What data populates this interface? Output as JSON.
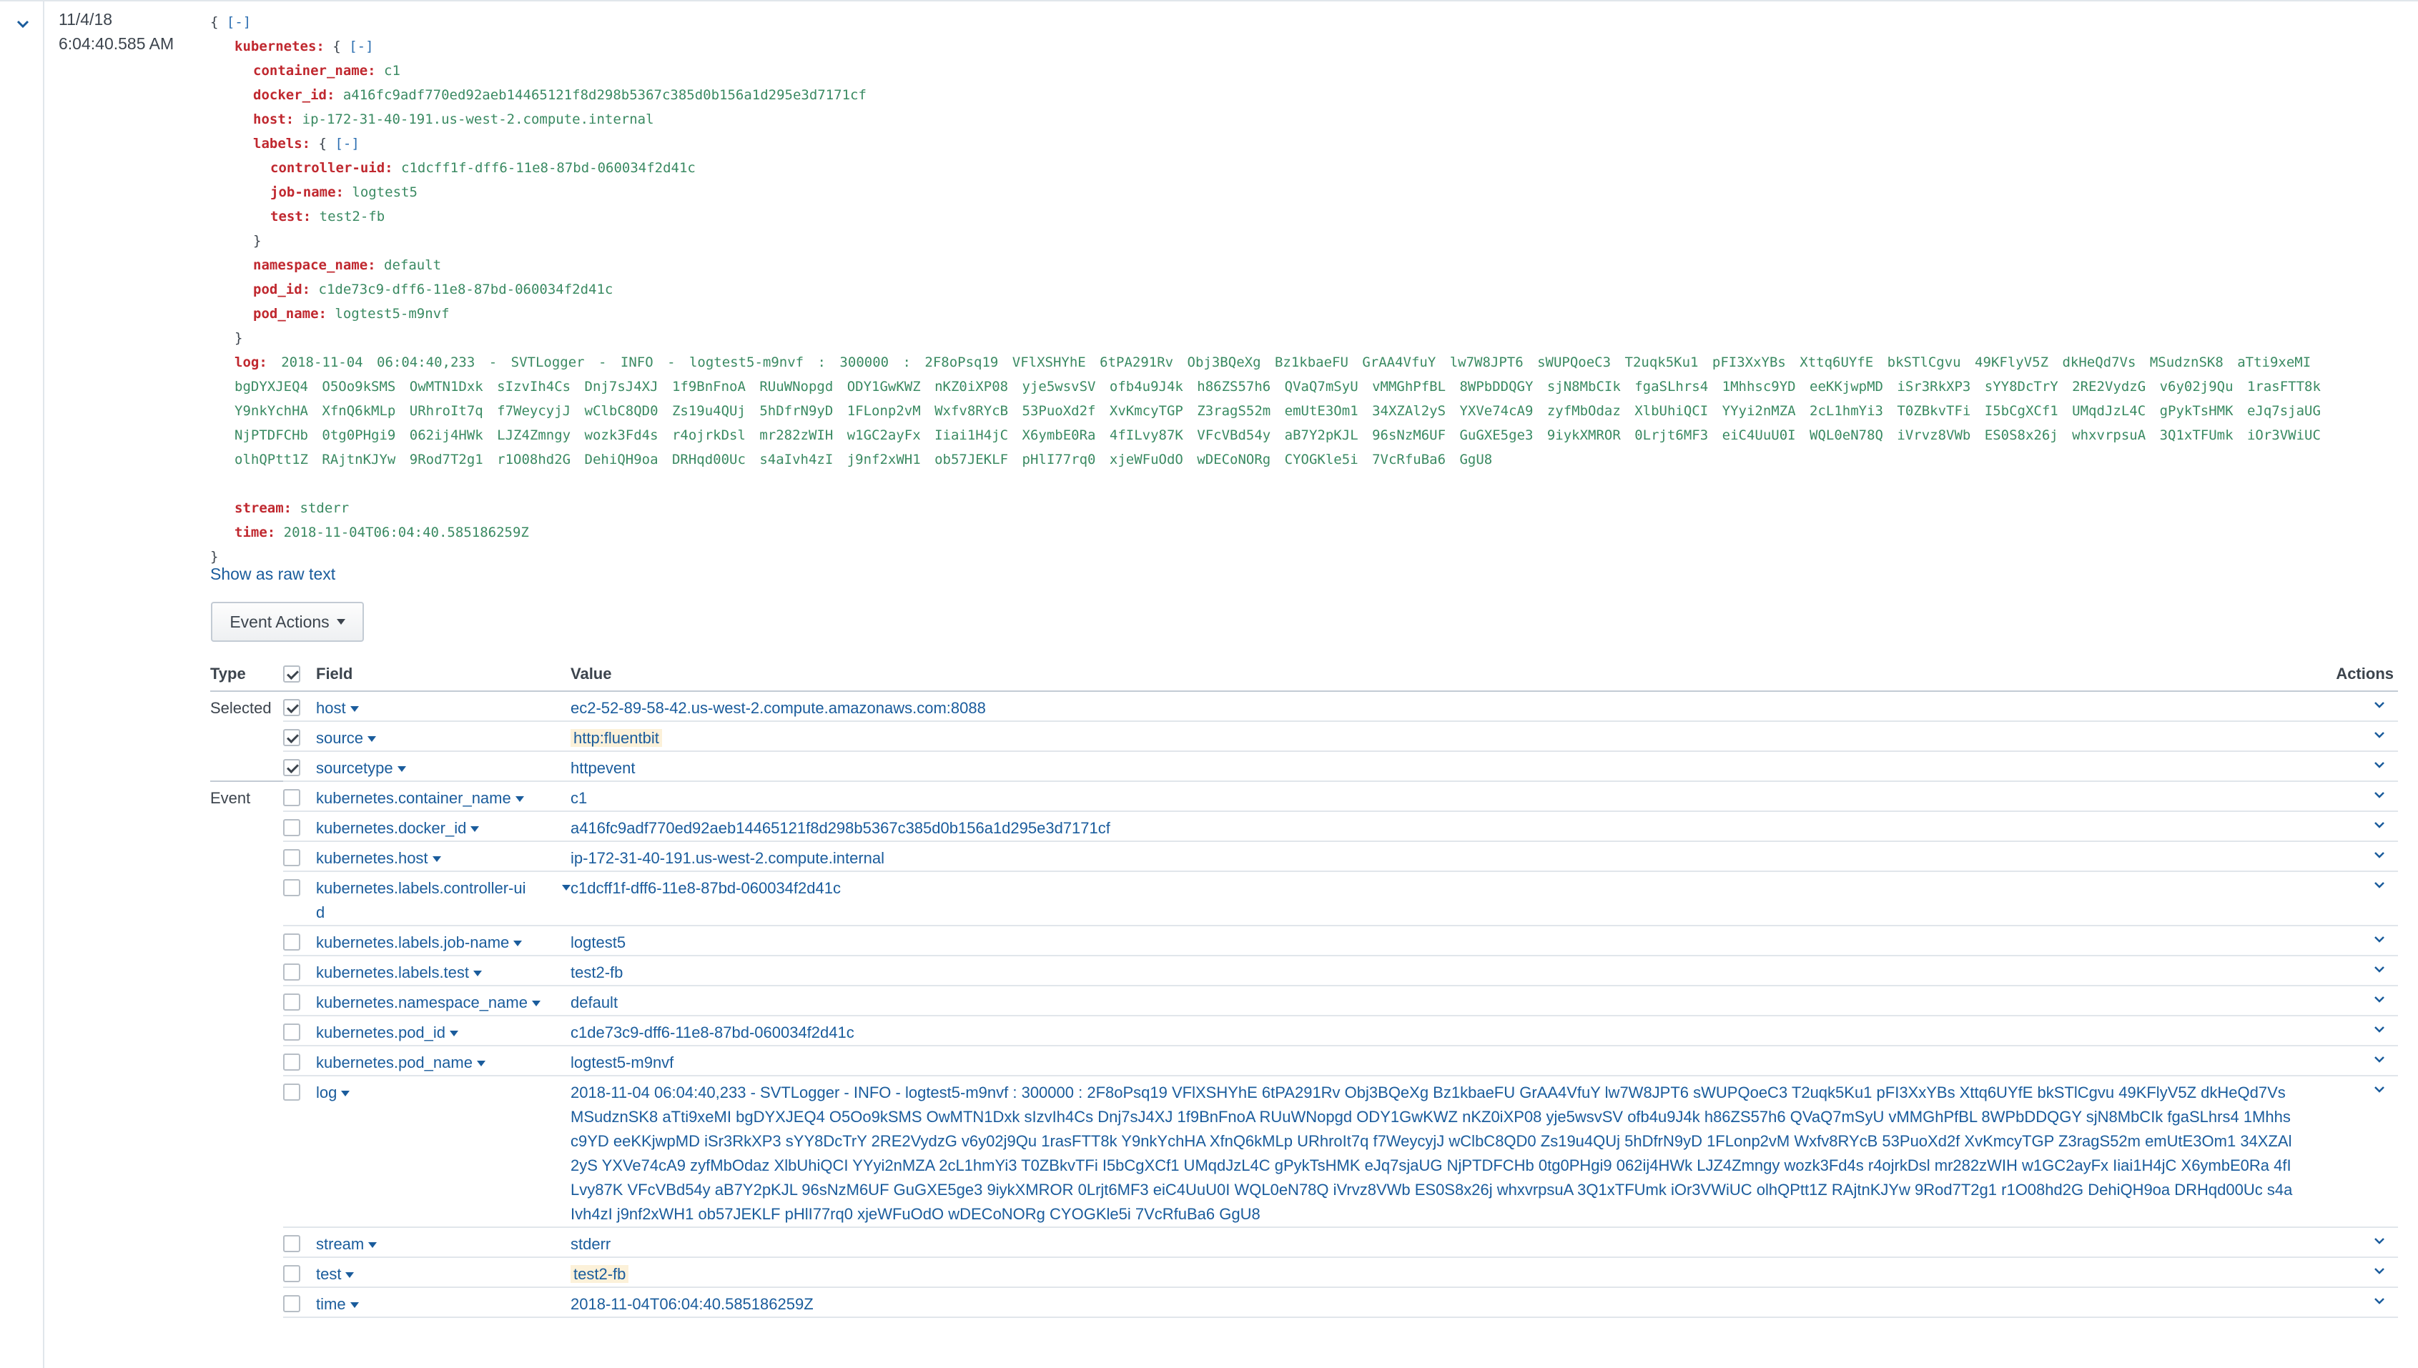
{
  "event": {
    "date": "11/4/18",
    "time": "6:04:40.585 AM"
  },
  "json_view": {
    "open_brace": "{",
    "close_brace": "}",
    "collapse_label": "[-]",
    "kubernetes_key": "kubernetes:",
    "container_name_key": "container_name:",
    "container_name": "c1",
    "docker_id_key": "docker_id:",
    "docker_id": "a416fc9adf770ed92aeb14465121f8d298b5367c385d0b156a1d295e3d7171cf",
    "host_key": "host:",
    "host": "ip-172-31-40-191.us-west-2.compute.internal",
    "labels_key": "labels:",
    "controller_uid_key": "controller-uid:",
    "controller_uid": "c1dcff1f-dff6-11e8-87bd-060034f2d41c",
    "job_name_key": "job-name:",
    "job_name": "logtest5",
    "test_key": "test:",
    "test": "test2-fb",
    "namespace_name_key": "namespace_name:",
    "namespace_name": "default",
    "pod_id_key": "pod_id:",
    "pod_id": "c1de73c9-dff6-11e8-87bd-060034f2d41c",
    "pod_name_key": "pod_name:",
    "pod_name": "logtest5-m9nvf",
    "log_key": "log:",
    "log": "2018-11-04 06:04:40,233 - SVTLogger - INFO - logtest5-m9nvf : 300000 : 2F8oPsq19 VFlXSHYhE 6tPA291Rv Obj3BQeXg Bz1kbaeFU GrAA4VfuY lw7W8JPT6 sWUPQoeC3 T2uqk5Ku1 pFI3XxYBs Xttq6UYfE bkSTlCgvu 49KFlyV5Z dkHeQd7Vs MSudznSK8 aTti9xeMI bgDYXJEQ4 O5Oo9kSMS OwMTN1Dxk sIzvIh4Cs Dnj7sJ4XJ 1f9BnFnoA RUuWNopgd ODY1GwKWZ nKZ0iXP08 yje5wsvSV ofb4u9J4k h86ZS57h6 QVaQ7mSyU vMMGhPfBL 8WPbDDQGY sjN8MbCIk fgaSLhrs4 1Mhhsc9YD eeKKjwpMD iSr3RkXP3 sYY8DcTrY 2RE2VydzG v6y02j9Qu 1rasFTT8k Y9nkYchHA XfnQ6kMLp URhroIt7q f7WeycyjJ wClbC8QD0 Zs19u4QUj 5hDfrN9yD 1FLonp2vM Wxfv8RYcB 53PuoXd2f XvKmcyTGP Z3ragS52m emUtE3Om1 34XZAl2yS YXVe74cA9 zyfMbOdaz XlbUhiQCI YYyi2nMZA 2cL1hmYi3 T0ZBkvTFi I5bCgXCf1 UMqdJzL4C gPykTsHMK eJq7sjaUG NjPTDFCHb 0tg0PHgi9 062ij4HWk LJZ4Zmngy wozk3Fd4s r4ojrkDsl mr282zWIH w1GC2ayFx Iiai1H4jC X6ymbE0Ra 4fILvy87K VFcVBd54y aB7Y2pKJL 96sNzM6UF GuGXE5ge3 9iykXMROR 0Lrjt6MF3 eiC4UuU0I WQL0eN78Q iVrvz8VWb ES0S8x26j whxvrpsuA 3Q1xTFUmk iOr3VWiUC olhQPtt1Z RAjtnKJYw 9Rod7T2g1 r1O08hd2G DehiQH9oa DRHqd00Uc s4aIvh4zI j9nf2xWH1 ob57JEKLF pHlI77rq0 xjeWFuOdO wDECoNORg CYOGKle5i 7VcRfuBa6 GgU8",
    "stream_key": "stream:",
    "stream": "stderr",
    "time_key": "time:",
    "time": "2018-11-04T06:04:40.585186259Z"
  },
  "show_raw_text": "Show as raw text",
  "event_actions_label": "Event Actions",
  "table": {
    "headers": {
      "type": "Type",
      "field": "Field",
      "value": "Value",
      "actions": "Actions"
    },
    "selected_label": "Selected",
    "event_label": "Event",
    "rows": [
      {
        "field": "host",
        "value": "ec2-52-89-58-42.us-west-2.compute.amazonaws.com:8088"
      },
      {
        "field": "source",
        "value": "http:fluentbit"
      },
      {
        "field": "sourcetype",
        "value": "httpevent"
      },
      {
        "field": "kubernetes.container_name",
        "value": "c1"
      },
      {
        "field": "kubernetes.docker_id",
        "value": "a416fc9adf770ed92aeb14465121f8d298b5367c385d0b156a1d295e3d7171cf"
      },
      {
        "field": "kubernetes.host",
        "value": "ip-172-31-40-191.us-west-2.compute.internal"
      },
      {
        "field": "kubernetes.labels.controller-uid",
        "value": "c1dcff1f-dff6-11e8-87bd-060034f2d41c"
      },
      {
        "field": "kubernetes.labels.job-name",
        "value": "logtest5"
      },
      {
        "field": "kubernetes.labels.test",
        "value": "test2-fb"
      },
      {
        "field": "kubernetes.namespace_name",
        "value": "default"
      },
      {
        "field": "kubernetes.pod_id",
        "value": "c1de73c9-dff6-11e8-87bd-060034f2d41c"
      },
      {
        "field": "kubernetes.pod_name",
        "value": "logtest5-m9nvf"
      },
      {
        "field": "log",
        "value": "2018-11-04 06:04:40,233 - SVTLogger - INFO - logtest5-m9nvf : 300000 : 2F8oPsq19 VFlXSHYhE 6tPA291Rv Obj3BQeXg Bz1kbaeFU GrAA4VfuY lw7W8JPT6 sWUPQoeC3 T2uqk5Ku1 pFI3XxYBs Xttq6UYfE bkSTlCgvu 49KFlyV5Z dkHeQd7Vs MSudznSK8 aTti9xeMI bgDYXJEQ4 O5Oo9kSMS OwMTN1Dxk sIzvIh4Cs Dnj7sJ4XJ 1f9BnFnoA RUuWNopgd ODY1GwKWZ nKZ0iXP08 yje5wsvSV ofb4u9J4k h86ZS57h6 QVaQ7mSyU vMMGhPfBL 8WPbDDQGY sjN8MbCIk fgaSLhrs4 1Mhhsc9YD eeKKjwpMD iSr3RkXP3 sYY8DcTrY 2RE2VydzG v6y02j9Qu 1rasFTT8k Y9nkYchHA XfnQ6kMLp URhroIt7q f7WeycyjJ wClbC8QD0 Zs19u4QUj 5hDfrN9yD 1FLonp2vM Wxfv8RYcB 53PuoXd2f XvKmcyTGP Z3ragS52m emUtE3Om1 34XZAl2yS YXVe74cA9 zyfMbOdaz XlbUhiQCI YYyi2nMZA 2cL1hmYi3 T0ZBkvTFi I5bCgXCf1 UMqdJzL4C gPykTsHMK eJq7sjaUG NjPTDFCHb 0tg0PHgi9 062ij4HWk LJZ4Zmngy wozk3Fd4s r4ojrkDsl mr282zWIH w1GC2ayFx Iiai1H4jC X6ymbE0Ra 4fILvy87K VFcVBd54y aB7Y2pKJL 96sNzM6UF GuGXE5ge3 9iykXMROR 0Lrjt6MF3 eiC4UuU0I WQL0eN78Q iVrvz8VWb ES0S8x26j whxvrpsuA 3Q1xTFUmk iOr3VWiUC olhQPtt1Z RAjtnKJYw 9Rod7T2g1 r1O08hd2G DehiQH9oa DRHqd00Uc s4aIvh4zI j9nf2xWH1 ob57JEKLF pHlI77rq0 xjeWFuOdO wDECoNORg CYOGKle5i 7VcRfuBa6 GgU8"
      },
      {
        "field": "stream",
        "value": "stderr"
      },
      {
        "field": "test",
        "value": "test2-fb"
      },
      {
        "field": "time",
        "value": "2018-11-04T06:04:40.585186259Z"
      }
    ]
  },
  "colors": {
    "json_key": "#c0282f",
    "json_value": "#3a8a62",
    "link": "#1a5c9c",
    "highlight": "#fcf1d9"
  },
  "icons": {
    "expand": "chevron-down-icon",
    "field_menu": "caret-down-icon",
    "row_actions": "chevron-down-icon",
    "checkbox": "checkbox-icon"
  }
}
